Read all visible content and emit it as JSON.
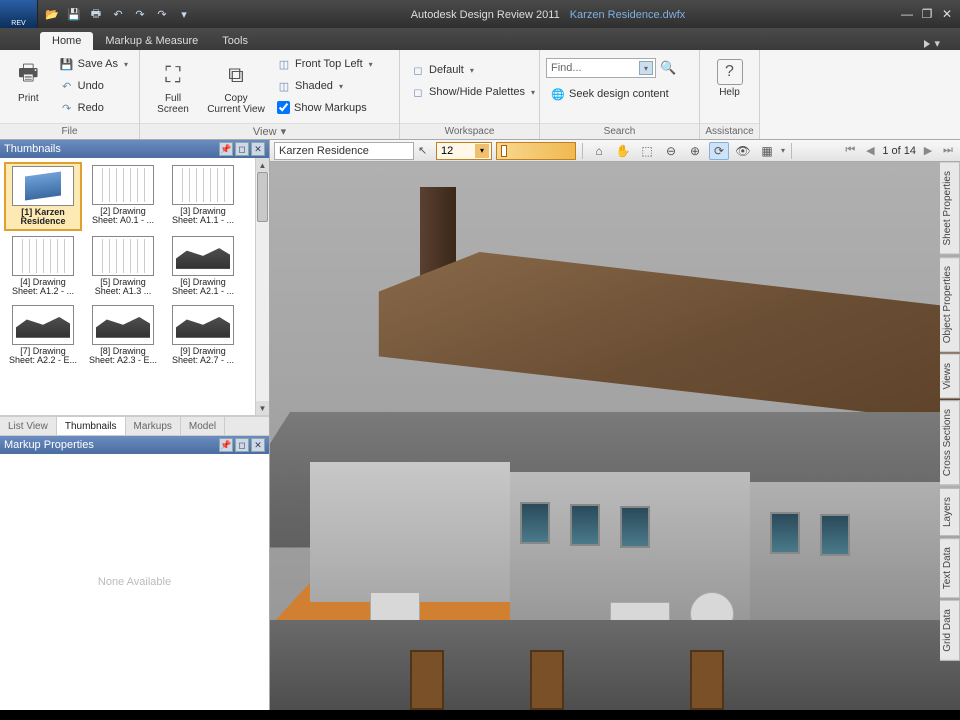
{
  "title": {
    "app": "Autodesk Design Review 2011",
    "file": "Karzen Residence.dwfx"
  },
  "app_icon_text": "REV",
  "qat": {
    "open": "open",
    "save": "save",
    "print": "print",
    "undo": "undo",
    "redo": "redo",
    "plot": "plot",
    "dd": "▾"
  },
  "tabs": {
    "home": "Home",
    "markup": "Markup & Measure",
    "tools": "Tools"
  },
  "ribbon": {
    "file": {
      "print": "Print",
      "saveas": "Save As",
      "undo": "Undo",
      "redo": "Redo",
      "label": "File"
    },
    "view": {
      "fullscreen": "Full Screen",
      "copyview": "Copy Current View",
      "front": "Front Top Left",
      "shaded": "Shaded",
      "showmk": "Show Markups",
      "label": "View"
    },
    "workspace": {
      "default": "Default",
      "palettes": "Show/Hide Palettes",
      "label": "Workspace"
    },
    "search": {
      "placeholder": "Find...",
      "seek": "Seek design content",
      "label": "Search"
    },
    "assist": {
      "help": "Help",
      "label": "Assistance"
    }
  },
  "thumbnails": {
    "title": "Thumbnails",
    "items": [
      {
        "label": "[1] Karzen Residence",
        "kind": "3d"
      },
      {
        "label": "[2] Drawing Sheet: A0.1 - ...",
        "kind": "sheet"
      },
      {
        "label": "[3] Drawing Sheet: A1.1 - ...",
        "kind": "sheet"
      },
      {
        "label": "[4] Drawing Sheet: A1.2 - ...",
        "kind": "sheet"
      },
      {
        "label": "[5] Drawing Sheet: A1.3 ...",
        "kind": "sheet"
      },
      {
        "label": "[6] Drawing Sheet: A2.1 - ...",
        "kind": "elev"
      },
      {
        "label": "[7] Drawing Sheet: A2.2 - E...",
        "kind": "elev"
      },
      {
        "label": "[8] Drawing Sheet: A2.3 - E...",
        "kind": "elev"
      },
      {
        "label": "[9] Drawing Sheet: A2.7 - ...",
        "kind": "elev"
      }
    ],
    "tabs": {
      "list": "List View",
      "thumbs": "Thumbnails",
      "markups": "Markups",
      "model": "Model"
    }
  },
  "markup_props": {
    "title": "Markup Properties",
    "empty": "None Available"
  },
  "canvas": {
    "docname": "Karzen Residence",
    "zoom": "12",
    "pager": "1 of 14"
  },
  "right_tabs": [
    "Sheet Properties",
    "Object Properties",
    "Views",
    "Cross Sections",
    "Layers",
    "Text Data",
    "Grid Data"
  ],
  "glyph": {
    "caret": "▾",
    "minimize": "—",
    "restore": "❐",
    "close": "✕",
    "home": "⌂",
    "hand": "✋",
    "pointer": "↖",
    "first": "⏮",
    "prev": "◀",
    "next": "▶",
    "last": "⏭",
    "help": "?",
    "print": "🖶",
    "screen": "⛶",
    "copy": "⧉",
    "cube": "◫",
    "binoc": "🔍",
    "globe": "🌐",
    "orbit": "⟳",
    "eye": "👁",
    "sect": "▦",
    "save": "💾",
    "open": "📂",
    "undo": "↶",
    "redo": "↷",
    "pin": "📌",
    "win": "◻"
  }
}
